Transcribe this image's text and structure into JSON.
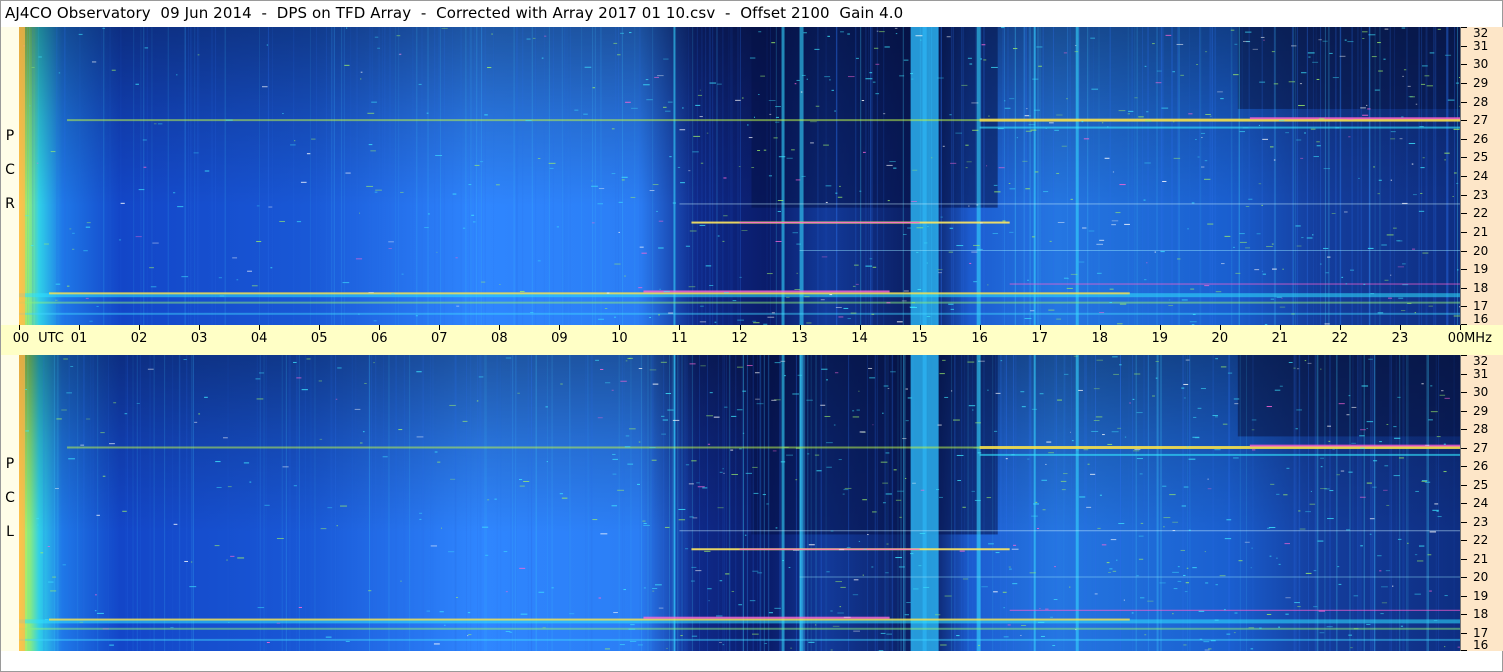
{
  "title": "AJ4CO Observatory  09 Jun 2014  -  DPS on TFD Array  -  Corrected with Array 2017 01 10.csv  -  Offset 2100  Gain 4.0",
  "panels": [
    {
      "label": [
        "R",
        "C",
        "P"
      ]
    },
    {
      "label": [
        "L",
        "C",
        "P"
      ]
    }
  ],
  "colors": {
    "background_level": "#1a5fd8",
    "quiet_level": "#0a1a6a",
    "hot_level": "#ff4fd0",
    "axis_utc_bg": "#ffffc6",
    "axis_freq_bg": "#fde6c8"
  },
  "chart_data": {
    "type": "heatmap",
    "title": "AJ4CO Observatory  09 Jun 2014  -  DPS on TFD Array  -  Corrected with Array 2017 01 10.csv  -  Offset 2100  Gain 4.0",
    "x_axis": {
      "unit": "UTC",
      "ticks": [
        "00",
        "01",
        "02",
        "03",
        "04",
        "05",
        "06",
        "07",
        "08",
        "09",
        "10",
        "11",
        "12",
        "13",
        "14",
        "15",
        "16",
        "17",
        "18",
        "19",
        "20",
        "21",
        "22",
        "23",
        "00"
      ],
      "range": [
        0,
        24
      ]
    },
    "y_axis": {
      "unit": "MHz",
      "ticks": [
        16,
        17,
        18,
        19,
        20,
        21,
        22,
        23,
        24,
        25,
        26,
        27,
        28,
        29,
        30,
        31,
        32
      ],
      "range": [
        16,
        32
      ]
    },
    "series": [
      {
        "name": "RCP"
      },
      {
        "name": "LCP"
      }
    ],
    "features": {
      "strong_band_freqs_mhz": [
        17.6,
        27.0,
        21.5
      ],
      "vertical_interference_hours": [
        10.9,
        12.7,
        13.0,
        14.85,
        15.05,
        15.95,
        16.9,
        17.6
      ]
    },
    "utc_label_unit_text": "UTC",
    "freq_label_unit_text": "MHz"
  }
}
